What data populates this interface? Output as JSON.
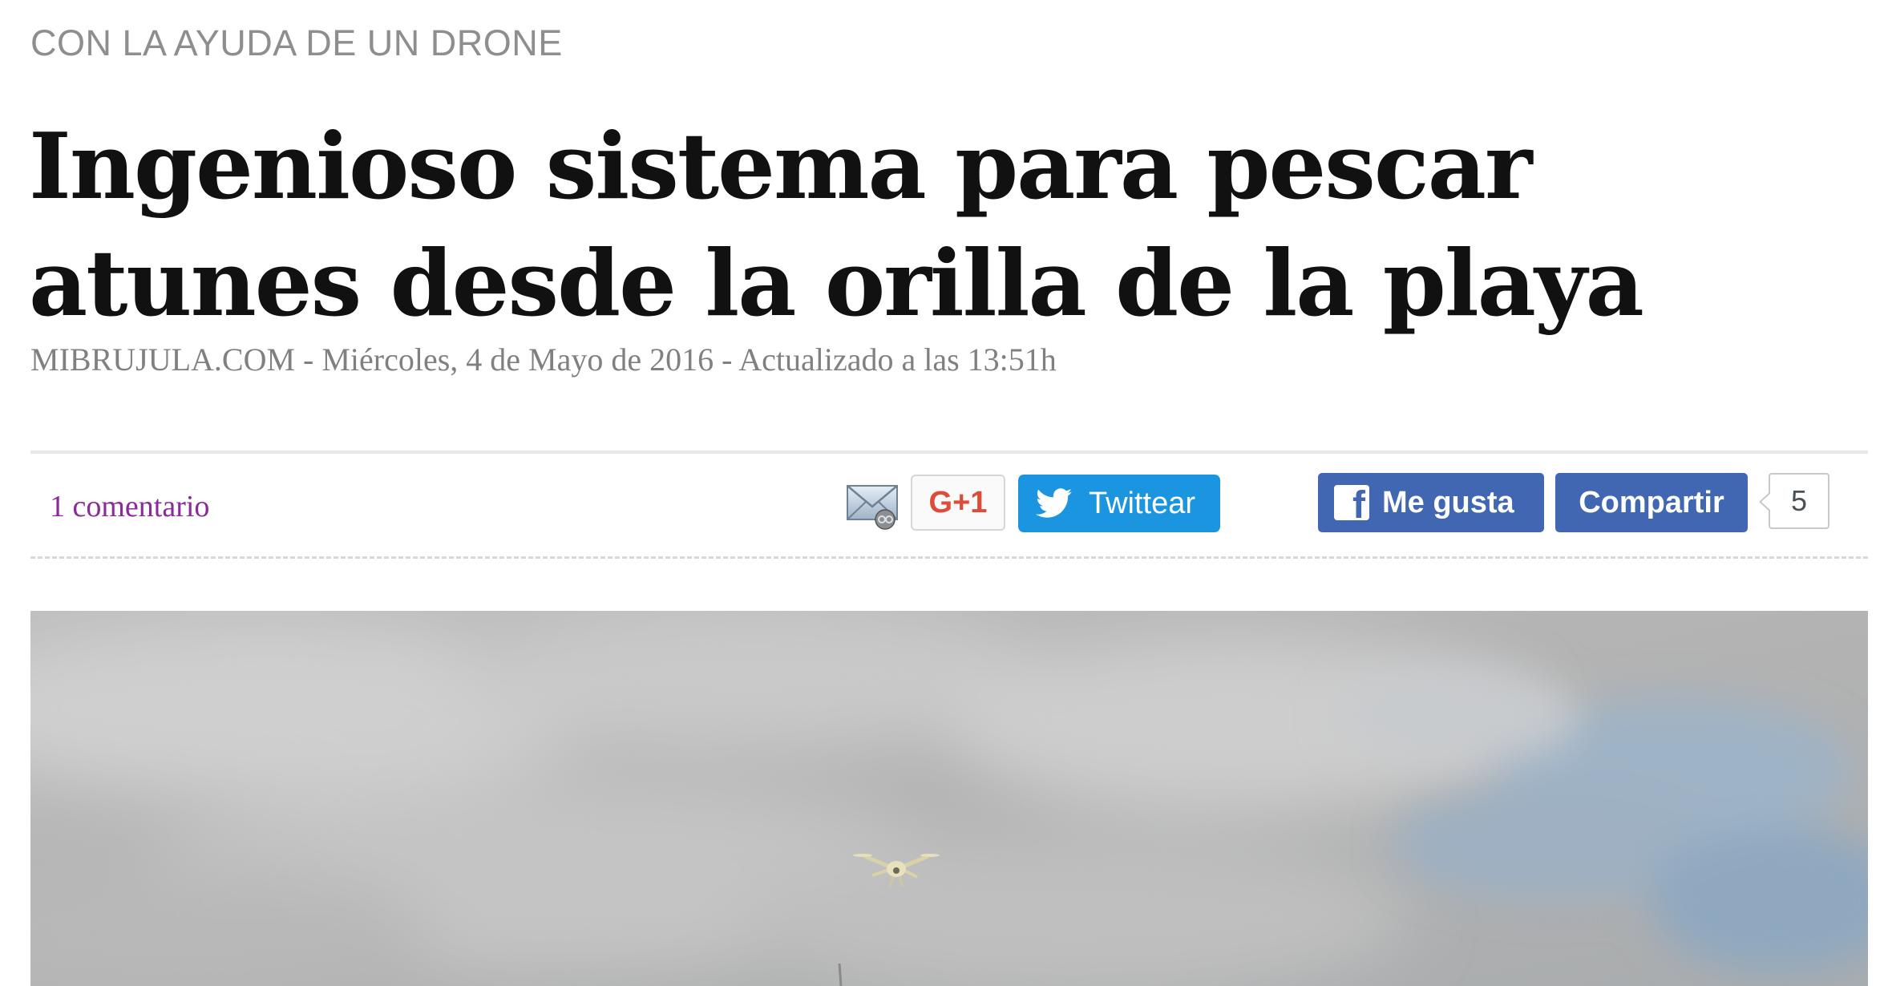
{
  "article": {
    "kicker": "CON LA AYUDA DE UN DRONE",
    "headline": "Ingenioso sistema para pescar atunes desde la orilla de la playa",
    "byline": "MIBRUJULA.COM - Miércoles, 4 de Mayo de 2016 - Actualizado a las 13:51h"
  },
  "share_bar": {
    "comments_label": "1 comentario",
    "email_icon": "email-icon",
    "gplus_label": "G+1",
    "twitter_icon": "twitter-bird-icon",
    "twitter_label": "Twittear",
    "facebook_icon": "facebook-f-icon",
    "fb_like_label": "Me gusta",
    "fb_share_label": "Compartir",
    "fb_count": "5"
  },
  "colors": {
    "comments_link": "#8b2a9a",
    "twitter": "#1b95e0",
    "facebook": "#4267b2",
    "gplus": "#dd4b39"
  }
}
